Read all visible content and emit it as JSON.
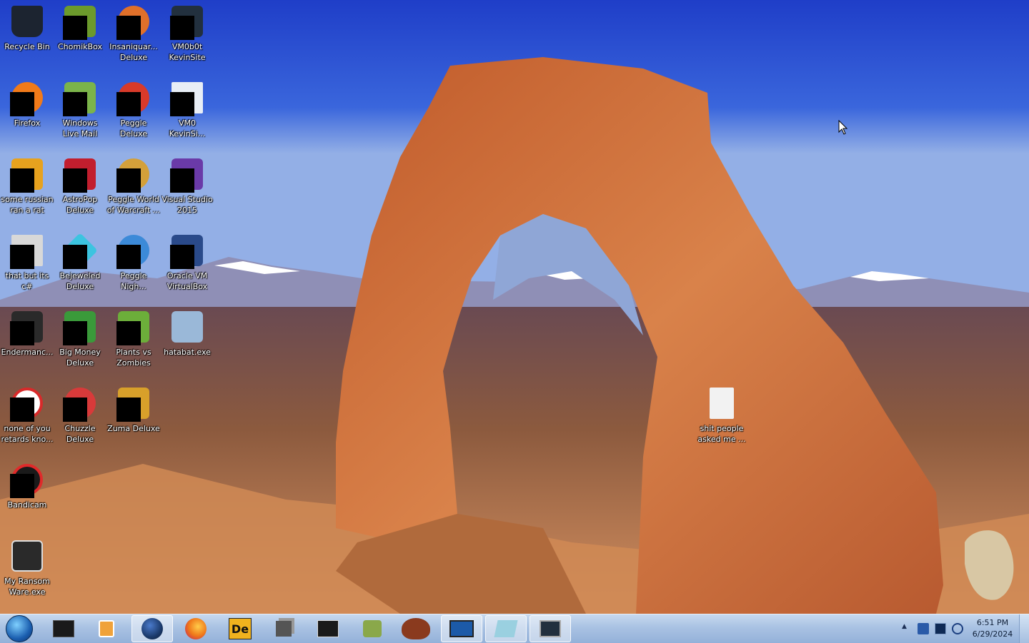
{
  "desktop_icons": [
    {
      "label": "Recycle Bin",
      "icon": "recycle-bin-icon",
      "color": "#1c2430"
    },
    {
      "label": "ChomikBox",
      "icon": "chomikbox-icon",
      "color": "#6c9a2c"
    },
    {
      "label": "Insaniquar...\nDeluxe",
      "icon": "insaniquarium-icon",
      "color": "#e0702a"
    },
    {
      "label": "VM0b0t\nKevinSite",
      "icon": "vm-computer-icon",
      "color": "#22303e"
    },
    {
      "label": "Firefox",
      "icon": "firefox-icon",
      "color": "#f07a1a"
    },
    {
      "label": "Windows\nLive Mail",
      "icon": "live-mail-icon",
      "color": "#7bb44a"
    },
    {
      "label": "Peggle\nDeluxe",
      "icon": "peggle-icon",
      "color": "#d83a2a"
    },
    {
      "label": "VM0\nKevinSi...",
      "icon": "document-icon",
      "color": "#e8eef6"
    },
    {
      "label": "some russian\nran a rat",
      "icon": "archive-icon",
      "color": "#e7a21e"
    },
    {
      "label": "AstroPop\nDeluxe",
      "icon": "astropop-icon",
      "color": "#c21e2e"
    },
    {
      "label": "Peggle World\nof Warcraft ...",
      "icon": "peggle-wow-icon",
      "color": "#d4a03a"
    },
    {
      "label": "Visual Studio\n2015",
      "icon": "visual-studio-icon",
      "color": "#6a3aa8"
    },
    {
      "label": "that but its\nc#",
      "icon": "copy-window-icon",
      "color": "#d8d8d8"
    },
    {
      "label": "Bejeweled\nDeluxe",
      "icon": "bejeweled-icon",
      "color": "#3cc4e0"
    },
    {
      "label": "Peggle\nNigh...",
      "icon": "peggle-nights-icon",
      "color": "#3c8ad8"
    },
    {
      "label": "Oracle VM\nVirtualBox",
      "icon": "virtualbox-icon",
      "color": "#2a4a8a"
    },
    {
      "label": "Endermanc...",
      "icon": "console-window-icon",
      "color": "#2a2a2a"
    },
    {
      "label": "Big Money\nDeluxe",
      "icon": "big-money-icon",
      "color": "#3a9a3a"
    },
    {
      "label": "Plants vs\nZombies",
      "icon": "plants-vs-zombies-icon",
      "color": "#6cae3a"
    },
    {
      "label": "hatabat.exe",
      "icon": "installer-icon",
      "color": "#9ab8d8"
    },
    {
      "label": "none of you\nretards kno...",
      "icon": "red-circle-icon",
      "color": "#d82a2a"
    },
    {
      "label": "Chuzzle\nDeluxe",
      "icon": "chuzzle-icon",
      "color": "#d83a3a"
    },
    {
      "label": "Zuma Deluxe",
      "icon": "zuma-icon",
      "color": "#d8a02a"
    },
    {
      "label": "Bandicam",
      "icon": "bandicam-icon",
      "color": "#e02a2a"
    },
    {
      "label": "My Ransom\nWare.exe",
      "icon": "console-window-icon",
      "color": "#2a2a2a"
    },
    {
      "label": "shit people\nasked me ...",
      "icon": "document-icon",
      "color": "#f2f2f2"
    }
  ],
  "taskbar": {
    "items": [
      {
        "name": "taskbar-cmd-window",
        "icon": "black-window-icon",
        "color": "#1a1a1a"
      },
      {
        "name": "taskbar-media-player",
        "icon": "media-player-icon",
        "color": "#f0a23a"
      },
      {
        "name": "taskbar-globe-app",
        "icon": "globe-icon",
        "color": "#1b3a6b"
      },
      {
        "name": "taskbar-firefox",
        "icon": "firefox-icon",
        "color": "#f07a1a"
      },
      {
        "name": "taskbar-bandicam-de",
        "icon": "de-icon",
        "color": "#f0b21e"
      },
      {
        "name": "taskbar-copy-window",
        "icon": "stack-window-icon",
        "color": "#666666"
      },
      {
        "name": "taskbar-console",
        "icon": "console-icon",
        "color": "#1a1a1a"
      },
      {
        "name": "taskbar-chomikbox",
        "icon": "hamster-icon",
        "color": "#8aa84a"
      },
      {
        "name": "taskbar-turkey",
        "icon": "turkey-icon",
        "color": "#8a3a1e"
      },
      {
        "name": "taskbar-vm-monitor",
        "icon": "monitor-icon",
        "color": "#1c5aa8"
      },
      {
        "name": "taskbar-installer",
        "icon": "installer-icon",
        "color": "#9ad0e0"
      },
      {
        "name": "taskbar-computer",
        "icon": "computer-icon",
        "color": "#22303e"
      }
    ],
    "clock": {
      "time": "6:51 PM",
      "date": "6/29/2024"
    }
  }
}
